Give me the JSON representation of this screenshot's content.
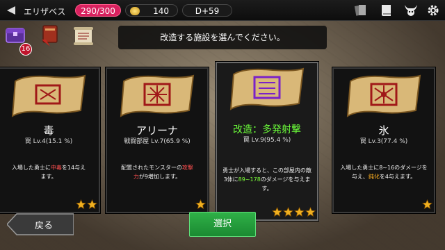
{
  "topbar": {
    "player_name": "エリザベス",
    "hp": "290/300",
    "gold": "140",
    "day": "D+59",
    "icons": [
      "back-triangle-icon",
      "cards-icon",
      "book-icon",
      "monster-horns-icon",
      "gear-icon"
    ]
  },
  "toolbar": {
    "icons": [
      "treasure-chest-icon",
      "spellbook-icon",
      "scroll-icon"
    ],
    "chest_badge": "16"
  },
  "instruction": "改造する施設を選んでください。",
  "cards": [
    {
      "title": "毒",
      "sub": "罠 Lv.4(15.1 %)",
      "desc": [
        "入場した勇士に",
        "中毒",
        "を14与え",
        "ます。"
      ],
      "stars": 2,
      "rune_color": "#a01818",
      "selected": false
    },
    {
      "title": "アリーナ",
      "sub": "戦闘部屋 Lv.7(65.9 %)",
      "desc": [
        "配置されたモンスターの",
        "攻撃",
        "力",
        "が9増加します。"
      ],
      "stars": 1,
      "rune_color": "#a01818",
      "selected": false
    },
    {
      "title": "改造：多発射撃",
      "sub": "罠 Lv.9(95.4 %)",
      "desc": [
        "勇士が入場すると、この部屋内の敵3体に",
        "89~178",
        "のダメージを与えます。"
      ],
      "stars": 4,
      "rune_color": "#7a22c8",
      "selected": true
    },
    {
      "title": "氷",
      "sub": "罠 Lv.3(77.4 %)",
      "desc": [
        "入場した勇士に8~16のダメージを与え、",
        "鈍化",
        "を4与えます。"
      ],
      "stars": 1,
      "rune_color": "#a01818",
      "selected": false
    }
  ],
  "buttons": {
    "back": "戻る",
    "select": "選択"
  },
  "colors": {
    "hp_pill": "#d8215f",
    "select_button": "#2fb047",
    "selected_title": "#6cff3a"
  }
}
